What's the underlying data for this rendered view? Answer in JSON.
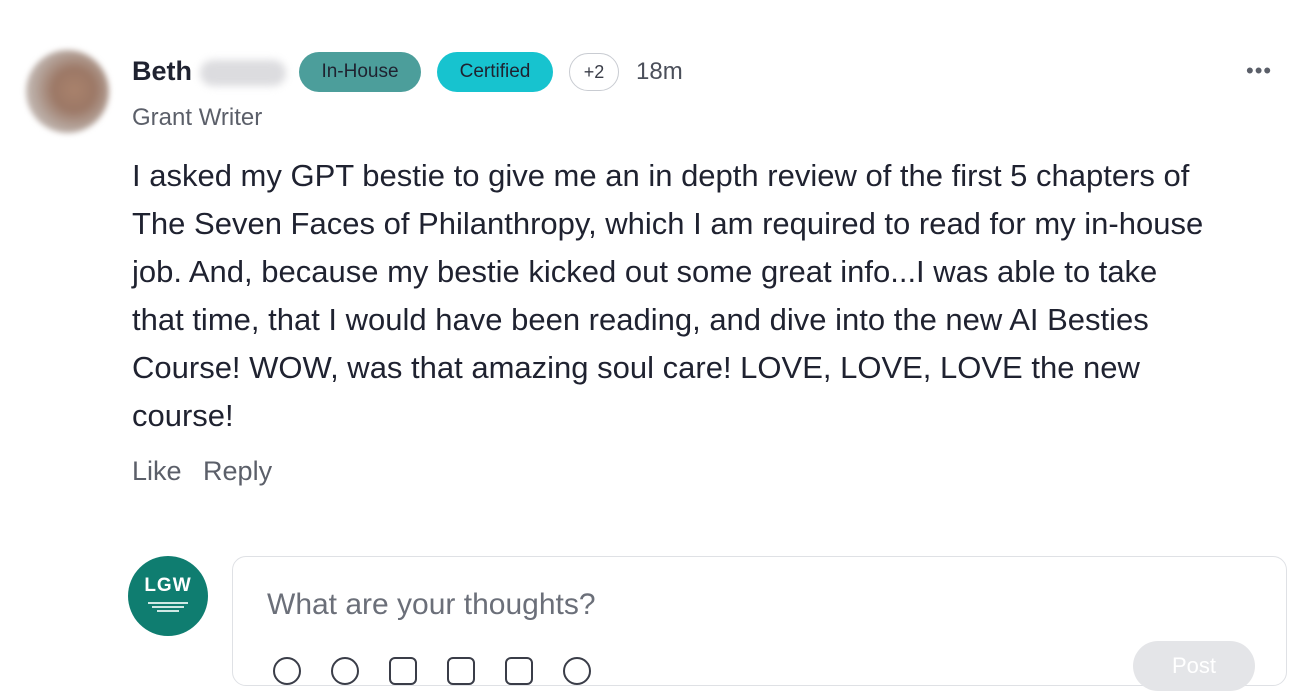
{
  "post": {
    "author_name": "Beth",
    "role": "Grant Writer",
    "badges": [
      "In-House",
      "Certified"
    ],
    "more_badges": "+2",
    "time_ago": "18m",
    "more_menu": "•••",
    "body": "I asked my GPT bestie to give me an in depth review of the first 5 chapters of The Seven Faces of Philanthropy, which I am required to read for my in-house job. And, because my bestie kicked out some great info...I was able to take that time, that I would have been reading, and dive into the new AI Besties Course! WOW, was that amazing soul care! LOVE, LOVE, LOVE the new course!",
    "actions": {
      "like": "Like",
      "reply": "Reply"
    }
  },
  "composer": {
    "avatar_text": "LGW",
    "placeholder": "What are your thoughts?",
    "post_label": "Post"
  },
  "colors": {
    "badge_inhouse": "#4c9e9b",
    "badge_certified": "#17c3cf",
    "avatar_lgw": "#0f7d70"
  }
}
